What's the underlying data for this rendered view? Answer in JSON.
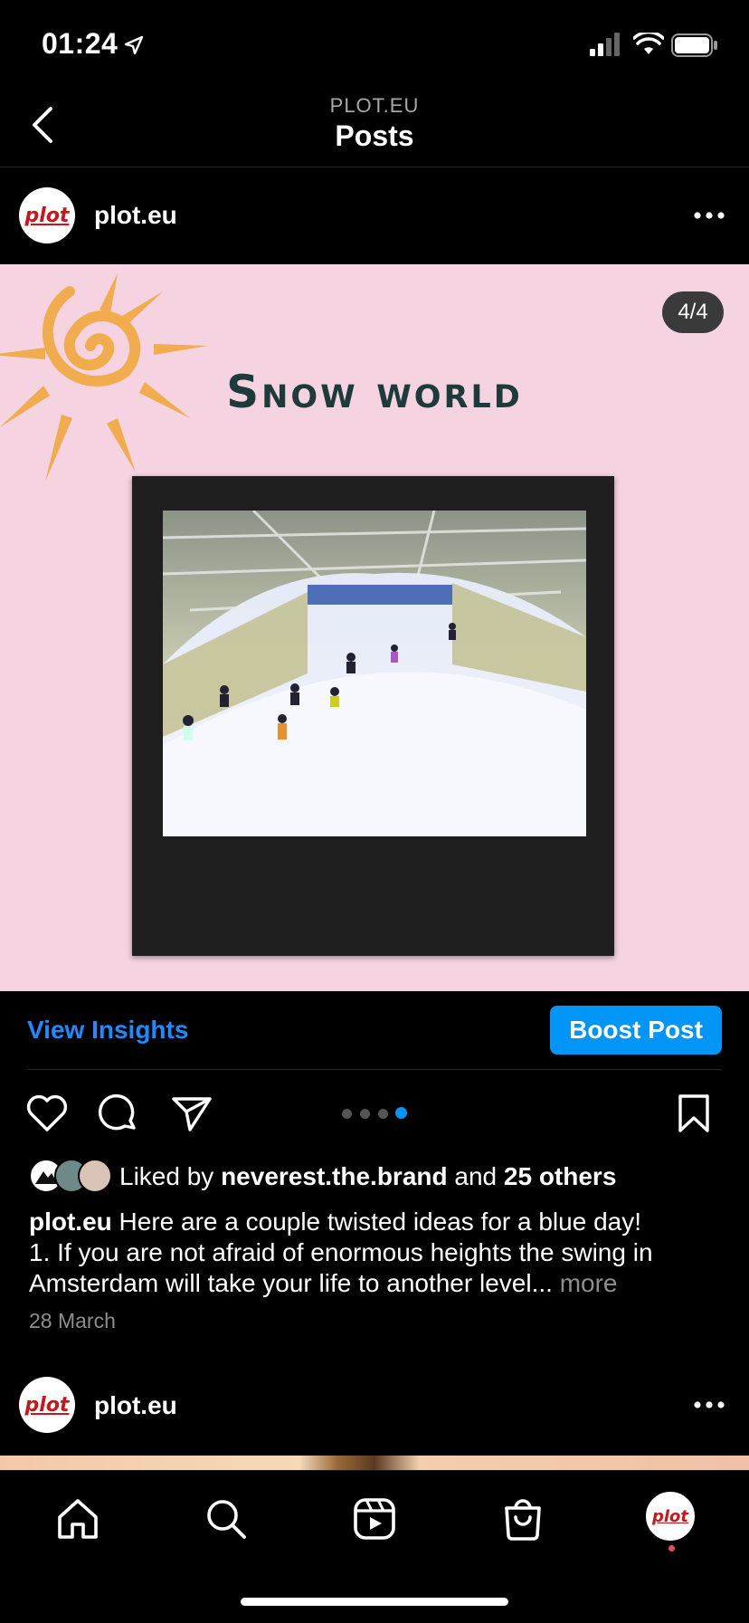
{
  "status_bar": {
    "time": "01:24"
  },
  "header": {
    "account": "PLOT.EU",
    "title": "Posts"
  },
  "post": {
    "username": "plot.eu",
    "avatar_text": "plot",
    "image_counter": "4/4",
    "image_title": "Snow world",
    "carousel": {
      "total": 4,
      "active": 4
    }
  },
  "actions": {
    "view_insights": "View Insights",
    "boost_post": "Boost Post"
  },
  "likes": {
    "prefix": "Liked by",
    "user": "neverest.the.brand",
    "and": "and",
    "others": "25 others"
  },
  "caption": {
    "username": "plot.eu",
    "line1": "Here are a couple twisted ideas for a blue day!",
    "line2": "1. If you are not afraid of enormous heights the swing in Amsterdam will take your life to another level...",
    "more": "more"
  },
  "date": "28 March",
  "next_post": {
    "username": "plot.eu",
    "avatar_text": "plot"
  },
  "tabbar": {
    "profile_avatar_text": "plot"
  },
  "colors": {
    "accent": "#0095f6",
    "link": "#1a8cff",
    "image_bg": "#f5d3e0",
    "notify": "#ed4956"
  }
}
